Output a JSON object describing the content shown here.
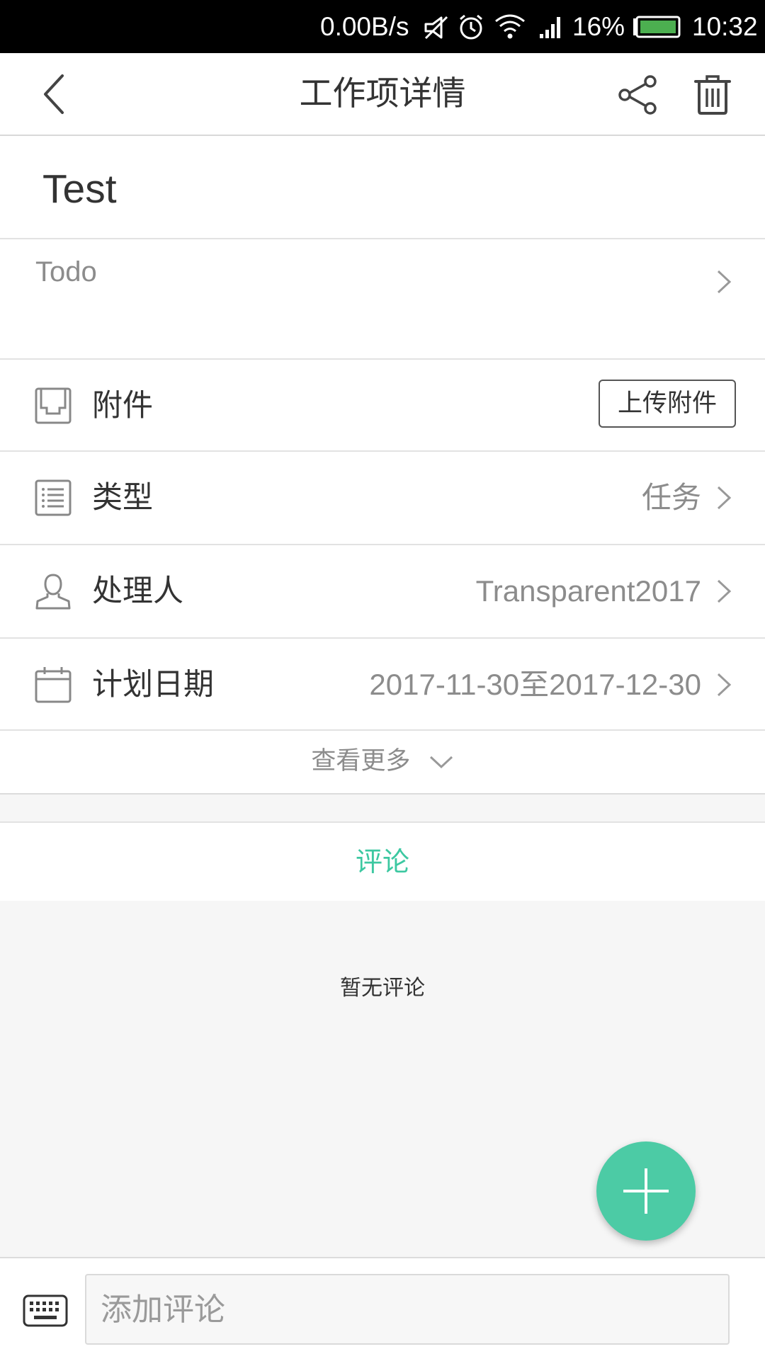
{
  "status_bar": {
    "speed": "0.00B/s",
    "battery": "16%",
    "time": "10:32",
    "battery_color": "#4caf50"
  },
  "header": {
    "title": "工作项详情"
  },
  "task": {
    "title": "Test",
    "status": "Todo"
  },
  "rows": {
    "attachment": {
      "label": "附件",
      "button": "上传附件"
    },
    "type": {
      "label": "类型",
      "value": "任务"
    },
    "assignee": {
      "label": "处理人",
      "value": "Transparent2017"
    },
    "plan_date": {
      "label": "计划日期",
      "value": "2017-11-30至2017-12-30"
    }
  },
  "see_more": "查看更多",
  "comments": {
    "tab_label": "评论",
    "empty_text": "暂无评论",
    "input_placeholder": "添加评论"
  },
  "colors": {
    "accent": "#3cc8a1",
    "fab": "#4ccba5"
  }
}
